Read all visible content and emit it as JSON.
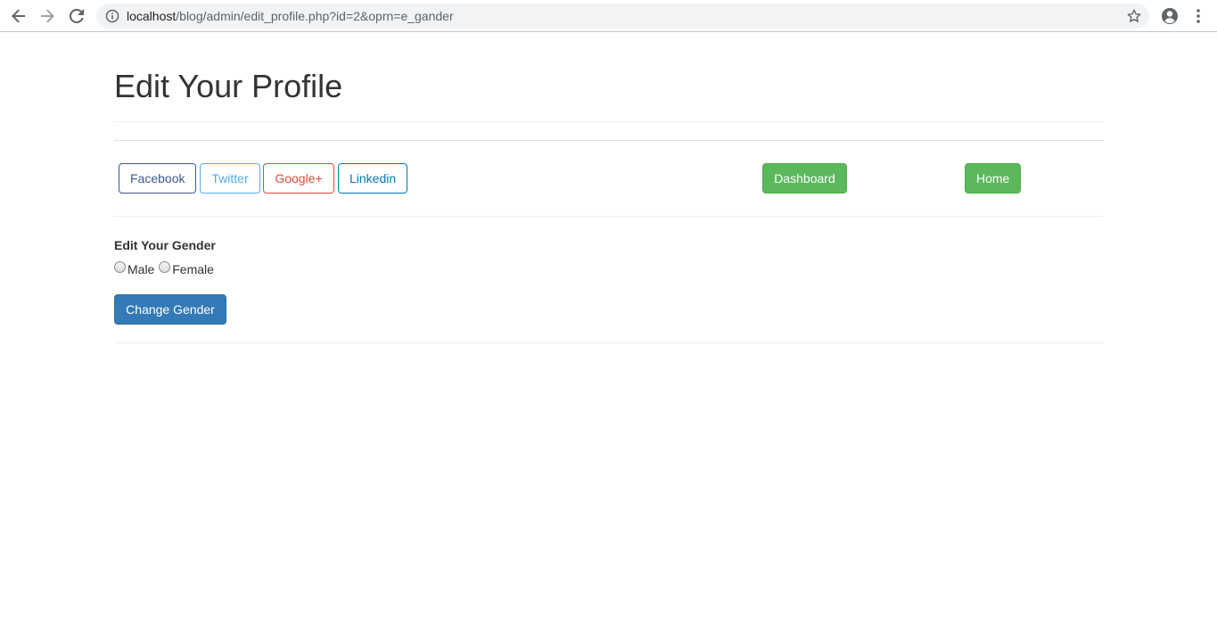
{
  "browser": {
    "url_host": "localhost",
    "url_path": "/blog/admin/edit_profile.php?id=2&oprn=e_gander"
  },
  "page": {
    "title": "Edit Your Profile"
  },
  "social_buttons": [
    {
      "label": "Facebook"
    },
    {
      "label": "Twitter"
    },
    {
      "label": "Google+"
    },
    {
      "label": "Linkedin"
    }
  ],
  "nav_buttons": {
    "dashboard_label": "Dashboard",
    "home_label": "Home"
  },
  "form": {
    "label": "Edit Your Gender",
    "options": [
      {
        "label": "Male",
        "checked": false
      },
      {
        "label": "Female",
        "checked": false
      }
    ],
    "submit_label": "Change Gender"
  },
  "colors": {
    "facebook": "#3b5998",
    "twitter": "#55acee",
    "google": "#dd4b39",
    "linkedin": "#007bb6",
    "success": "#5cb85c",
    "primary": "#337ab7"
  },
  "icons": [
    "back-arrow-icon",
    "forward-arrow-icon",
    "reload-icon",
    "info-icon",
    "star-icon",
    "profile-icon",
    "menu-icon"
  ]
}
